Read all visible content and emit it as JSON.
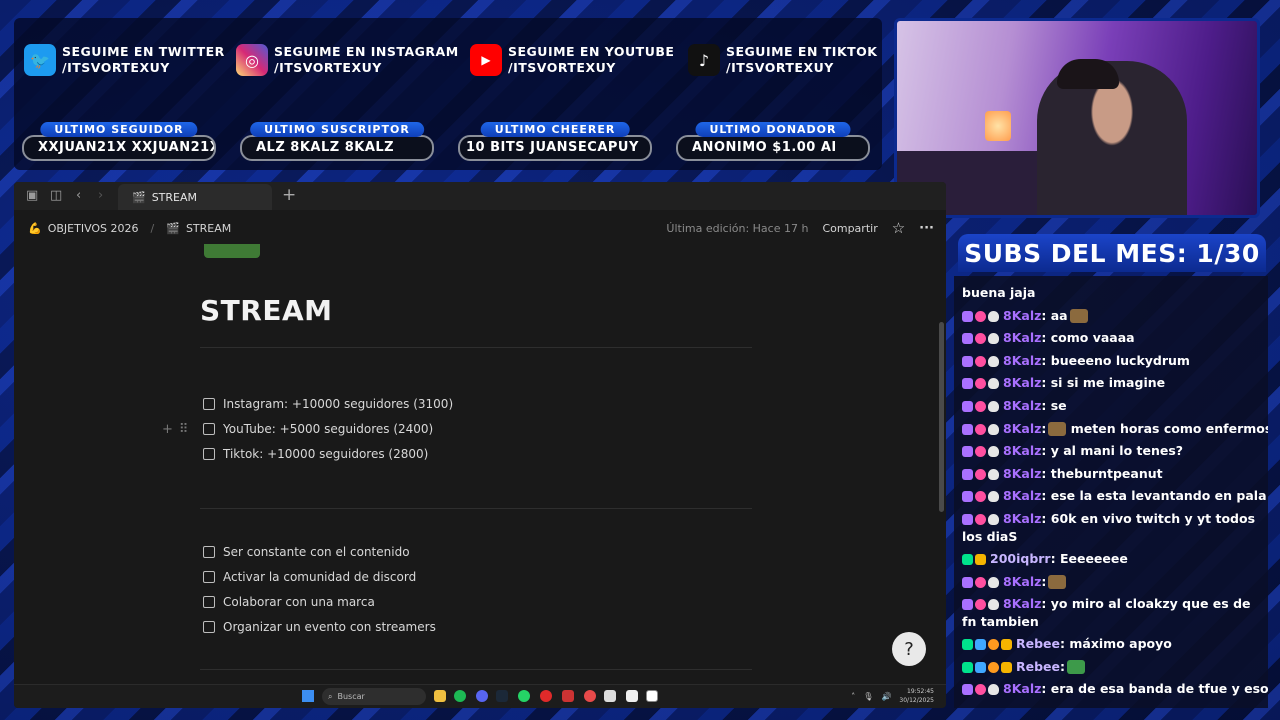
{
  "socials": [
    {
      "line1": "SEGUIME EN TWITTER",
      "line2": "/ITSVORTEXUY",
      "icon": "twitter-icon",
      "color": "#1d9bf0",
      "glyph": "🐦"
    },
    {
      "line1": "SEGUIME EN INSTAGRAM",
      "line2": "/ITSVORTEXUY",
      "icon": "instagram-icon",
      "color": "#d62976",
      "glyph": "◎"
    },
    {
      "line1": "SEGUIME EN YOUTUBE",
      "line2": "/ITSVORTEXUY",
      "icon": "youtube-icon",
      "color": "#ff0000",
      "glyph": "▶"
    },
    {
      "line1": "SEGUIME EN TIKTOK",
      "line2": "/ITSVORTEXUY",
      "icon": "tiktok-icon",
      "color": "#111111",
      "glyph": "♪"
    }
  ],
  "stats": [
    {
      "label": "ULTIMO SEGUIDOR",
      "value": "XXJUAN21X        XXJUAN21X"
    },
    {
      "label": "ULTIMO SUSCRIPTOR",
      "value": "ALZ          8KALZ          8KALZ"
    },
    {
      "label": "ULTIMO CHEERER",
      "value": "10 BITS        JUANSECAPUY"
    },
    {
      "label": "ULTIMO DONADOR",
      "value": "      ANONIMO $1.00        AI"
    }
  ],
  "browser": {
    "tab_title": "STREAM",
    "new_tab": "+",
    "breadcrumb": [
      "OBJETIVOS 2026",
      "STREAM"
    ],
    "breadcrumb_sep": "/",
    "last_edited": "Última edición: Hace 17 h",
    "share": "Compartir",
    "star": "☆",
    "more": "···"
  },
  "page": {
    "title": "STREAM",
    "todos_group1": [
      "Instagram: +10000 seguidores (3100)",
      "YouTube: +5000 seguidores (2400)",
      "Tiktok: +10000 seguidores (2800)"
    ],
    "todos_group2": [
      "Ser constante con el contenido",
      "Activar la comunidad de discord",
      "Colaborar con una marca",
      "Organizar un evento con streamers"
    ],
    "help": "?"
  },
  "taskbar": {
    "search_placeholder": "Buscar",
    "time": "19:52:45",
    "date": "30/12/2025"
  },
  "subs_banner": "SUBS DEL MES: 1/30",
  "chat": [
    {
      "user": "",
      "text": "buena jaja",
      "user_color": "#ffffff",
      "badges": []
    },
    {
      "user": "8Kalz",
      "text": ": aa",
      "user_color": "#a970ff",
      "badges": [
        "purple",
        "pink",
        "skull"
      ],
      "emote": "brown"
    },
    {
      "user": "8Kalz",
      "text": ": como vaaaa",
      "user_color": "#a970ff",
      "badges": [
        "purple",
        "pink",
        "skull"
      ]
    },
    {
      "user": "8Kalz",
      "text": ": bueeeno luckydrum",
      "user_color": "#a970ff",
      "badges": [
        "purple",
        "pink",
        "skull"
      ]
    },
    {
      "user": "8Kalz",
      "text": ": si si me imagine",
      "user_color": "#a970ff",
      "badges": [
        "purple",
        "pink",
        "skull"
      ]
    },
    {
      "user": "8Kalz",
      "text": ": se",
      "user_color": "#a970ff",
      "badges": [
        "purple",
        "pink",
        "skull"
      ]
    },
    {
      "user": "8Kalz",
      "text": ":",
      "user_color": "#a970ff",
      "badges": [
        "purple",
        "pink",
        "skull"
      ],
      "emote": "brown",
      "after": " meten horas como enfermos"
    },
    {
      "user": "8Kalz",
      "text": ": y al mani lo tenes?",
      "user_color": "#a970ff",
      "badges": [
        "purple",
        "pink",
        "skull"
      ]
    },
    {
      "user": "8Kalz",
      "text": ": theburntpeanut",
      "user_color": "#a970ff",
      "badges": [
        "purple",
        "pink",
        "skull"
      ]
    },
    {
      "user": "8Kalz",
      "text": ": ese la esta levantando en pala",
      "user_color": "#a970ff",
      "badges": [
        "purple",
        "pink",
        "skull"
      ]
    },
    {
      "user": "8Kalz",
      "text": ": 60k en vivo twitch y yt todos los diaS",
      "user_color": "#a970ff",
      "badges": [
        "purple",
        "pink",
        "skull"
      ],
      "wrap": true
    },
    {
      "user": "200iqbrr",
      "text": ": Eeeeeeee",
      "user_color": "#c8b6ff",
      "badges": [
        "green",
        "gold"
      ]
    },
    {
      "user": "8Kalz",
      "text": ":",
      "user_color": "#a970ff",
      "badges": [
        "purple",
        "pink",
        "skull"
      ],
      "emote": "brown"
    },
    {
      "user": "8Kalz",
      "text": ": yo miro al cloakzy que es de fn tambien",
      "user_color": "#a970ff",
      "badges": [
        "purple",
        "pink",
        "skull"
      ],
      "wrap": true
    },
    {
      "user": "Rebee",
      "text": ": máximo apoyo",
      "user_color": "#c8b6ff",
      "badges": [
        "green",
        "blue",
        "orange",
        "gold"
      ]
    },
    {
      "user": "Rebee",
      "text": ":",
      "user_color": "#c8b6ff",
      "badges": [
        "green",
        "blue",
        "orange",
        "gold"
      ],
      "emote": "green"
    },
    {
      "user": "8Kalz",
      "text": ": era de esa banda de tfue y eso",
      "user_color": "#a970ff",
      "badges": [
        "purple",
        "pink",
        "skull"
      ]
    }
  ]
}
